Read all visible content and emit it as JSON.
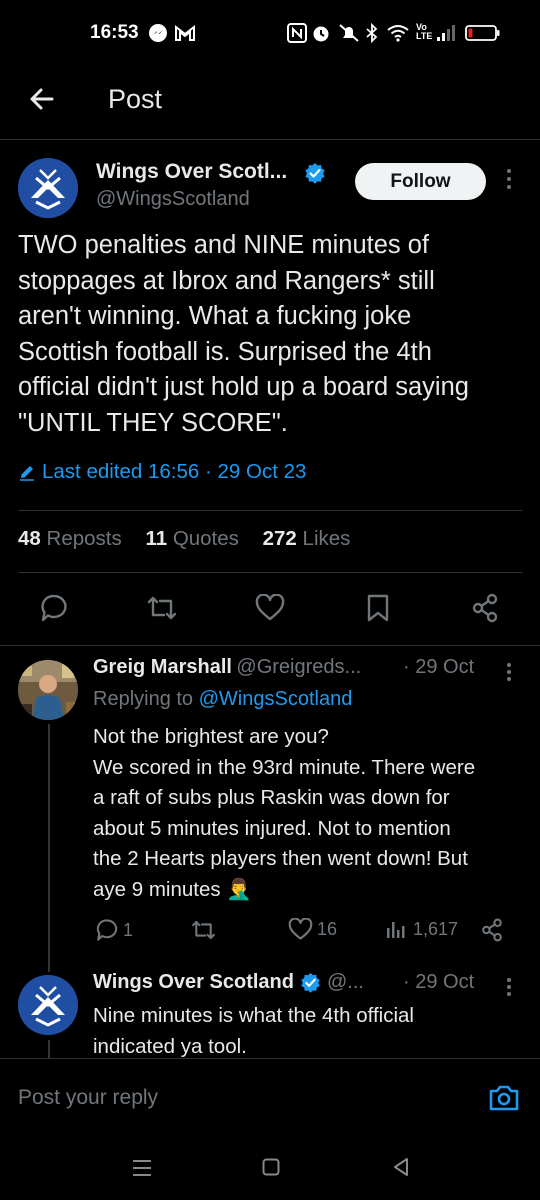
{
  "status_bar": {
    "time": "16:53",
    "network": "Vo LTE"
  },
  "header": {
    "title": "Post"
  },
  "tweet": {
    "author": "Wings Over Scotl...",
    "handle": "@WingsScotland",
    "follow_label": "Follow",
    "text_lines": [
      "TWO penalties and NINE minutes of",
      "stoppages at Ibrox and Rangers* still",
      "aren't winning. What a fucking joke",
      "Scottish football is. Surprised the 4th",
      "official didn't just hold up a board saying",
      "\"UNTIL THEY SCORE\"."
    ],
    "edited": "Last edited 16:56 · 29 Oct 23",
    "stats": {
      "reposts_count": "48",
      "reposts_label": "Reposts",
      "quotes_count": "11",
      "quotes_label": "Quotes",
      "likes_count": "272",
      "likes_label": "Likes"
    }
  },
  "replies": [
    {
      "author": "Greig Marshall",
      "handle": "@Greigreds...",
      "date": "· 29 Oct",
      "replying_prefix": "Replying to ",
      "replying_to": "@WingsScotland",
      "text_lines": [
        "Not the brightest are you?",
        "We scored in the 93rd minute. There were",
        "a raft of subs plus Raskin was down for",
        "about 5 minutes injured. Not to mention",
        "the 2 Hearts players then went down! But",
        "aye 9 minutes 🤦‍♂️"
      ],
      "reply_count": "1",
      "repost_count": "",
      "like_count": "16",
      "view_count": "1,617"
    },
    {
      "author": "Wings Over Scotland",
      "handle": "@...",
      "date": "· 29 Oct",
      "text_lines": [
        "Nine minutes is what the 4th official",
        "indicated ya tool."
      ]
    }
  ],
  "reply_box": {
    "placeholder": "Post your reply"
  },
  "colors": {
    "background": "#000000",
    "accent": "#1d9bf0",
    "text": "#e7e9ea",
    "muted": "#71767b",
    "divider": "#2f3336"
  }
}
